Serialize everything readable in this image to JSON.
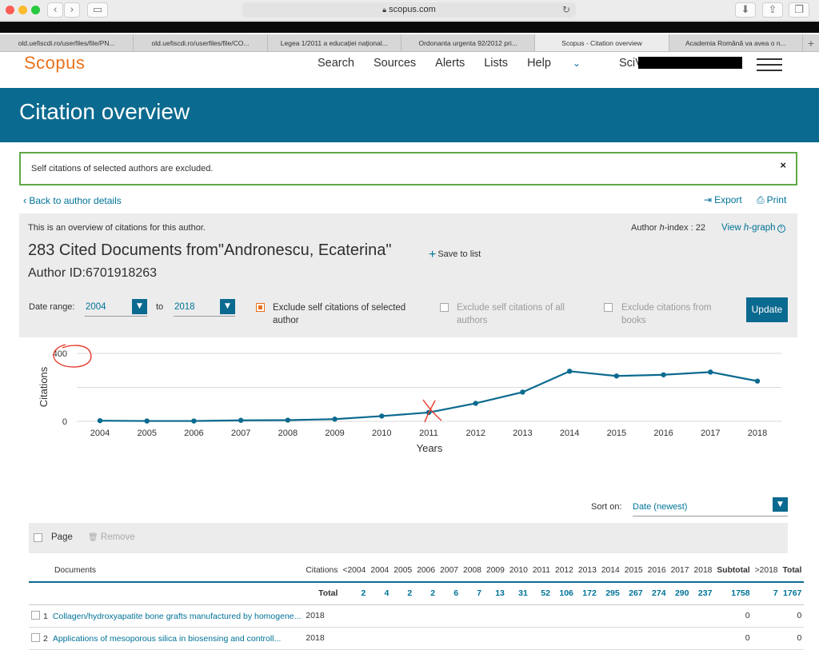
{
  "browser": {
    "url": "scopus.com",
    "tabs": [
      {
        "label": "old.uefiscdi.ro/userfiles/file/PN...",
        "active": false
      },
      {
        "label": "old.uefiscdi.ro/userfiles/file/CO...",
        "active": false
      },
      {
        "label": "Legea 1/2011 a educației național...",
        "active": false
      },
      {
        "label": "Ordonanta urgenta 92/2012 pri...",
        "active": false
      },
      {
        "label": "Scopus - Citation overview",
        "active": true
      },
      {
        "label": "Academia Română va avea o n...",
        "active": false
      }
    ]
  },
  "header": {
    "logo": "Scopus",
    "nav": {
      "search": "Search",
      "sources": "Sources",
      "alerts": "Alerts",
      "lists": "Lists",
      "help": "Help",
      "scival": "SciVal"
    }
  },
  "banner": {
    "title": "Citation overview"
  },
  "notice": {
    "message": "Self citations of selected authors are excluded.",
    "close": "×"
  },
  "actions": {
    "back": "Back to author details",
    "export": "Export",
    "print": "Print"
  },
  "overview": {
    "intro": "This is an overview of citations for this author.",
    "hindex_prefix": "Author ",
    "hindex_h": "h",
    "hindex_suffix": "-index : 22",
    "view_prefix": "View ",
    "view_h": "h",
    "view_suffix": "-graph",
    "title": "283 Cited Documents from\"Andronescu, Ecaterina\"",
    "save": "Save to list",
    "author_id": "Author ID:6701918263"
  },
  "filters": {
    "date_range_label": "Date range:",
    "from": "2004",
    "to_label": "to",
    "to": "2018",
    "exclude_selected": "Exclude self citations of selected author",
    "exclude_all": "Exclude self citations of all authors",
    "exclude_books": "Exclude citations from books",
    "update": "Update"
  },
  "chart_data": {
    "type": "line",
    "ylabel": "Citations",
    "xlabel": "Years",
    "x": [
      "2004",
      "2005",
      "2006",
      "2007",
      "2008",
      "2009",
      "2010",
      "2011",
      "2012",
      "2013",
      "2014",
      "2015",
      "2016",
      "2017",
      "2018"
    ],
    "series": [
      {
        "values": [
          4,
          2,
          2,
          6,
          7,
          13,
          31,
          52,
          106,
          172,
          295,
          267,
          274,
          290,
          237
        ]
      }
    ],
    "ylim": [
      0,
      400
    ],
    "yticks": [
      "0",
      "400"
    ],
    "grid": true,
    "color": "#0b6a8f",
    "annotation_color": "#e8392b"
  },
  "sort": {
    "label": "Sort on:",
    "value": "Date (newest)"
  },
  "pagebar": {
    "page": "Page",
    "remove": "Remove"
  },
  "table": {
    "headers": [
      "Documents",
      "Citations",
      "<2004",
      "2004",
      "2005",
      "2006",
      "2007",
      "2008",
      "2009",
      "2010",
      "2011",
      "2012",
      "2013",
      "2014",
      "2015",
      "2016",
      "2017",
      "2018",
      "Subtotal",
      ">2018",
      "Total"
    ],
    "total_row": {
      "label": "Total",
      "values": [
        "2",
        "4",
        "2",
        "2",
        "6",
        "7",
        "13",
        "31",
        "52",
        "106",
        "172",
        "295",
        "267",
        "274",
        "290",
        "237",
        "1758",
        "7",
        "1767"
      ]
    },
    "rows": [
      {
        "num": "1",
        "title": "Collagen/hydroxyapatite bone grafts manufactured by homogene...",
        "year": "2018",
        "subtotal": "0",
        "total": "0"
      },
      {
        "num": "2",
        "title": "Applications of mesoporous silica in biosensing and controll...",
        "year": "2018",
        "subtotal": "0",
        "total": "0"
      }
    ]
  }
}
